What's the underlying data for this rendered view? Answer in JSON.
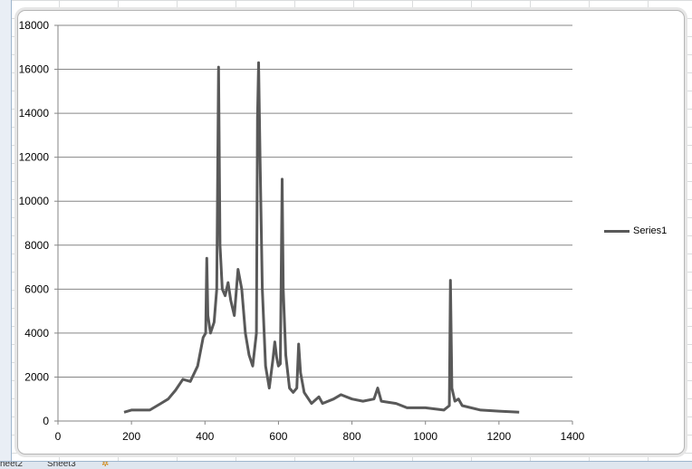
{
  "sheet_tabs": [
    {
      "label": "heet2"
    },
    {
      "label": "Sheet3"
    }
  ],
  "insert_sheet_icon": "insert-sheet-icon",
  "colors": {
    "series": "#595959",
    "grid": "#868686"
  },
  "chart_data": {
    "type": "line",
    "title": "",
    "xlabel": "",
    "ylabel": "",
    "xlim": [
      0,
      1400
    ],
    "ylim": [
      0,
      18000
    ],
    "xticks": [
      0,
      200,
      400,
      600,
      800,
      1000,
      1200,
      1400
    ],
    "yticks": [
      0,
      2000,
      4000,
      6000,
      8000,
      10000,
      12000,
      14000,
      16000,
      18000
    ],
    "grid": "horizontal",
    "legend_position": "right",
    "series": [
      {
        "name": "Series1",
        "points": [
          [
            180,
            400
          ],
          [
            200,
            500
          ],
          [
            250,
            500
          ],
          [
            280,
            800
          ],
          [
            300,
            1000
          ],
          [
            320,
            1400
          ],
          [
            340,
            1900
          ],
          [
            360,
            1800
          ],
          [
            380,
            2500
          ],
          [
            395,
            3800
          ],
          [
            402,
            4000
          ],
          [
            405,
            7400
          ],
          [
            408,
            4800
          ],
          [
            415,
            4000
          ],
          [
            425,
            4500
          ],
          [
            432,
            6000
          ],
          [
            437,
            16100
          ],
          [
            441,
            8000
          ],
          [
            447,
            6000
          ],
          [
            455,
            5700
          ],
          [
            463,
            6300
          ],
          [
            470,
            5500
          ],
          [
            480,
            4800
          ],
          [
            490,
            6900
          ],
          [
            500,
            6000
          ],
          [
            510,
            4000
          ],
          [
            520,
            3000
          ],
          [
            530,
            2500
          ],
          [
            540,
            4000
          ],
          [
            543,
            13800
          ],
          [
            546,
            16300
          ],
          [
            550,
            12000
          ],
          [
            556,
            6000
          ],
          [
            565,
            2500
          ],
          [
            575,
            1500
          ],
          [
            585,
            2800
          ],
          [
            590,
            3600
          ],
          [
            595,
            2900
          ],
          [
            600,
            2500
          ],
          [
            605,
            2600
          ],
          [
            610,
            11000
          ],
          [
            613,
            6000
          ],
          [
            620,
            3000
          ],
          [
            630,
            1500
          ],
          [
            640,
            1300
          ],
          [
            650,
            1500
          ],
          [
            655,
            3500
          ],
          [
            660,
            2200
          ],
          [
            670,
            1300
          ],
          [
            690,
            800
          ],
          [
            710,
            1100
          ],
          [
            720,
            800
          ],
          [
            750,
            1000
          ],
          [
            770,
            1200
          ],
          [
            800,
            1000
          ],
          [
            830,
            900
          ],
          [
            860,
            1000
          ],
          [
            870,
            1500
          ],
          [
            880,
            900
          ],
          [
            920,
            800
          ],
          [
            950,
            600
          ],
          [
            1000,
            600
          ],
          [
            1050,
            500
          ],
          [
            1065,
            700
          ],
          [
            1068,
            6400
          ],
          [
            1072,
            1500
          ],
          [
            1080,
            900
          ],
          [
            1090,
            1000
          ],
          [
            1100,
            700
          ],
          [
            1150,
            500
          ],
          [
            1200,
            450
          ],
          [
            1255,
            400
          ]
        ]
      }
    ]
  }
}
